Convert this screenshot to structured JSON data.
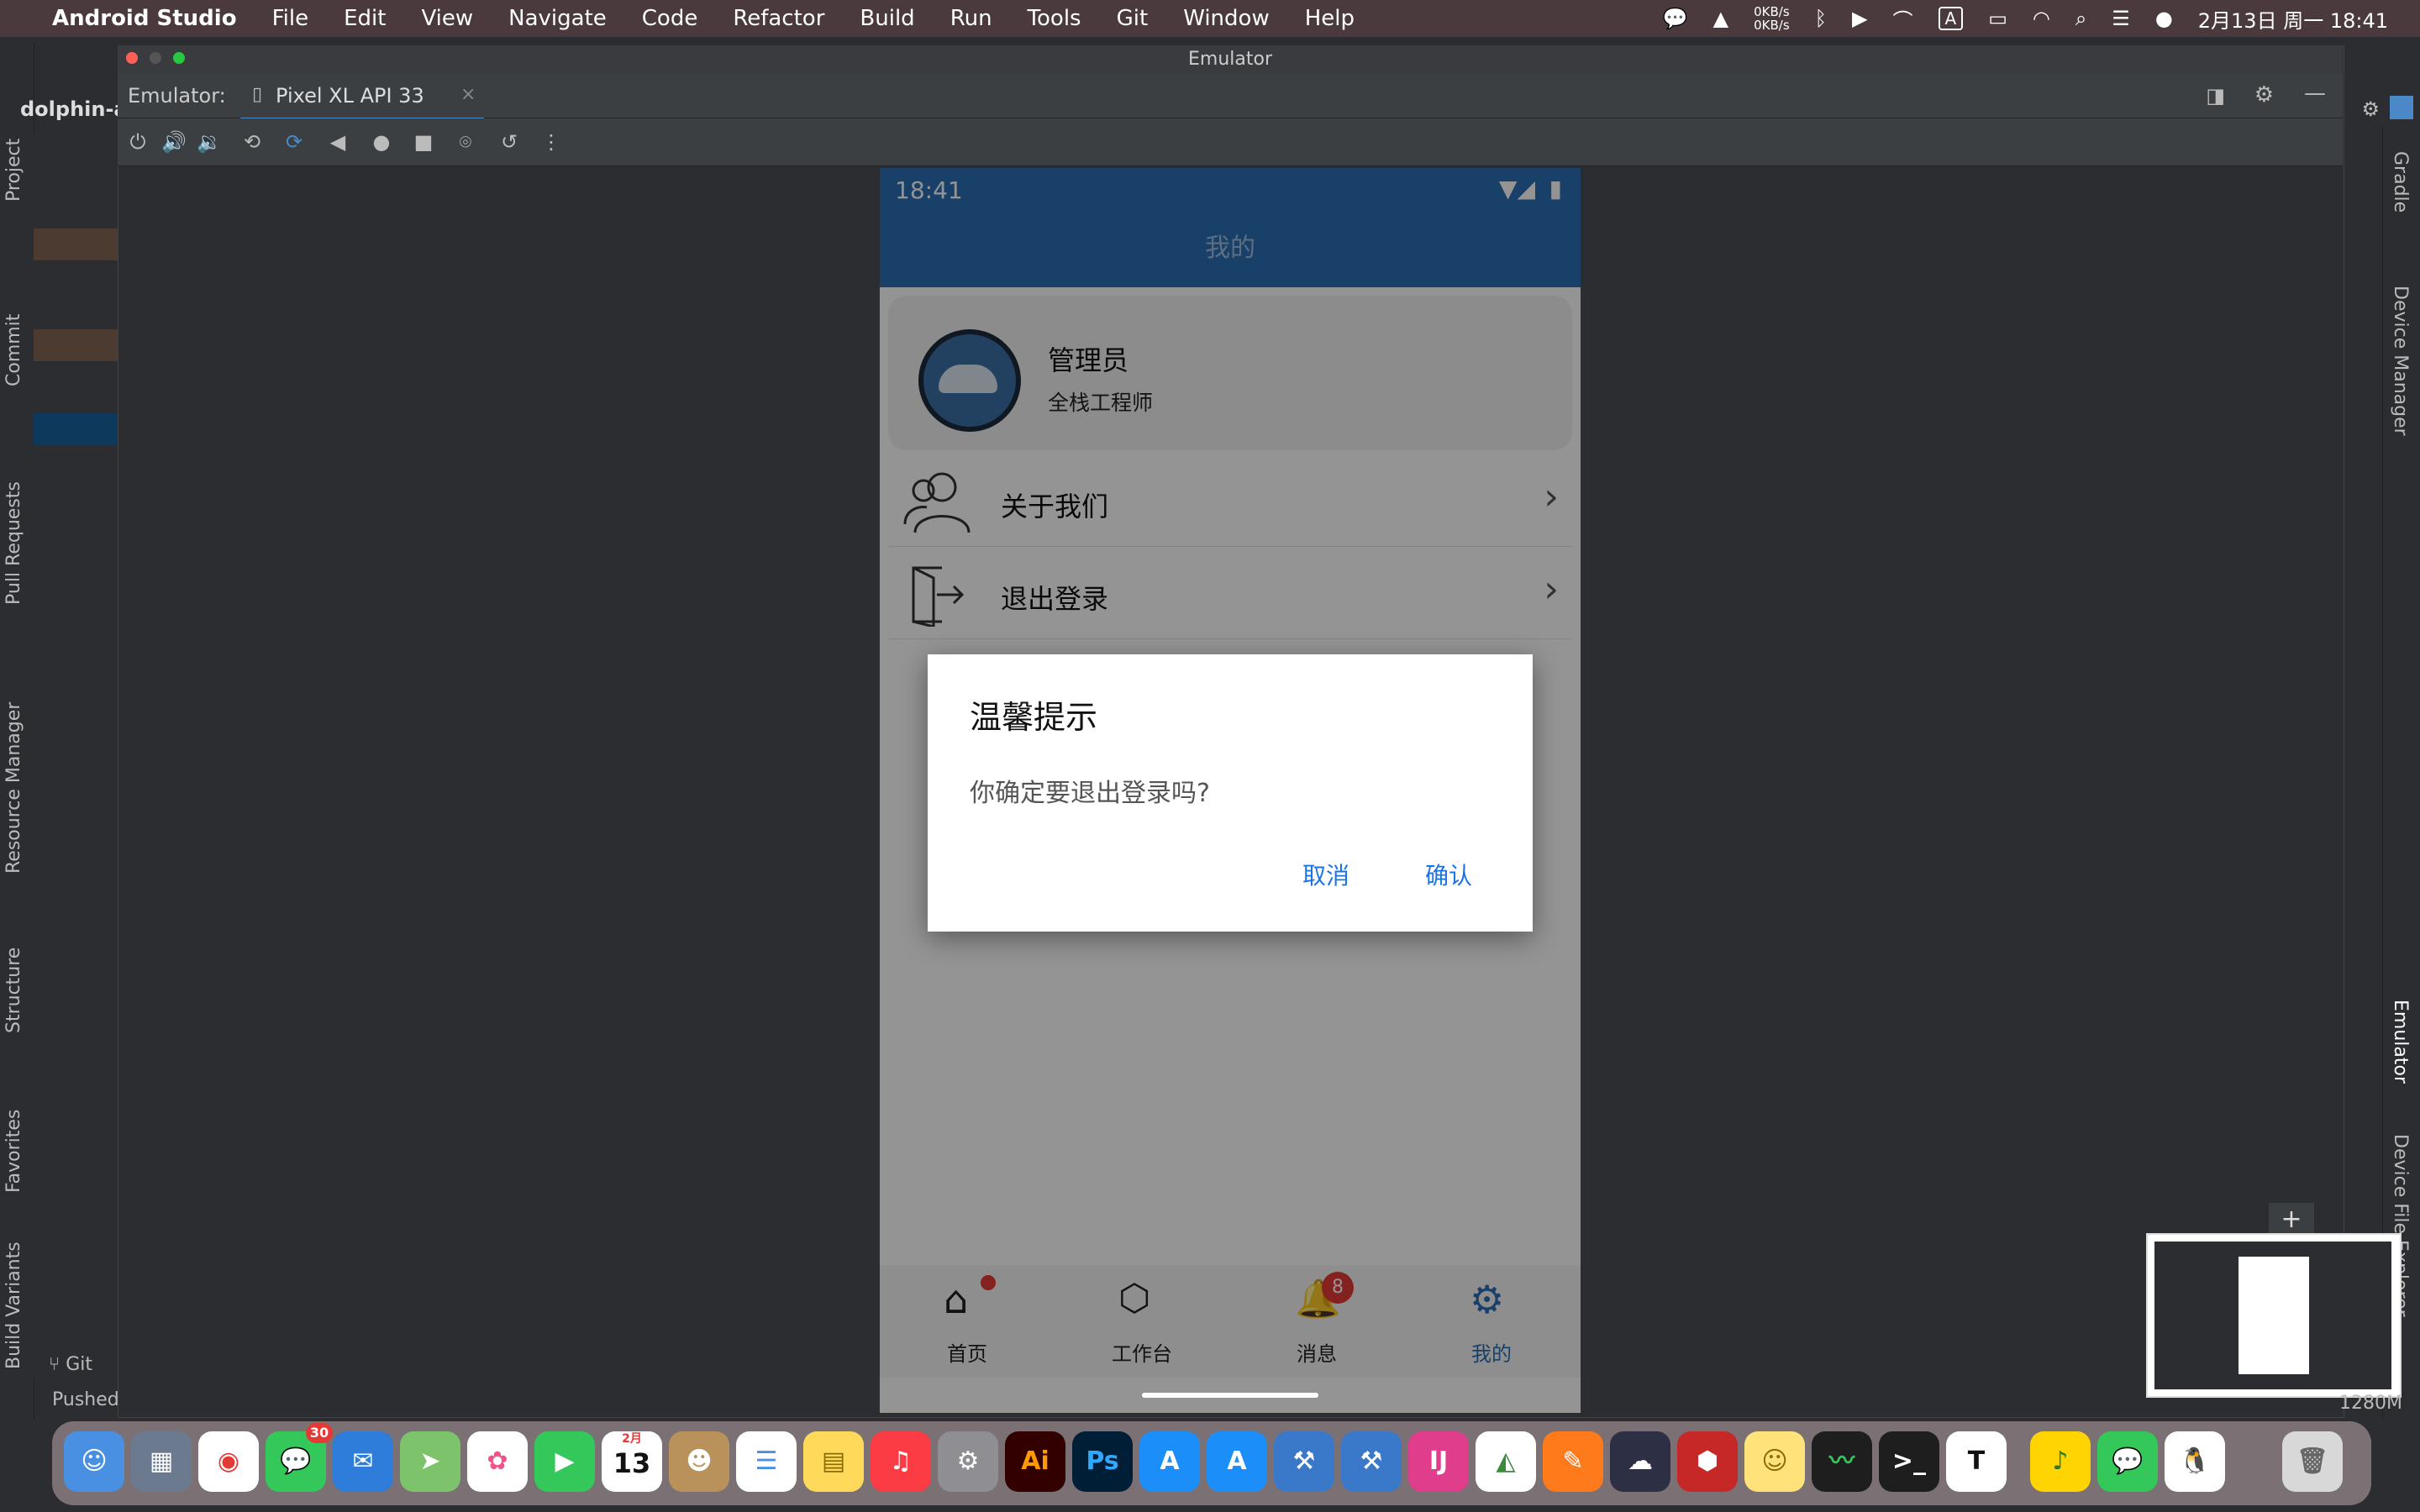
{
  "menubar": {
    "app_name": "Android Studio",
    "items": [
      "File",
      "Edit",
      "View",
      "Navigate",
      "Code",
      "Refactor",
      "Build",
      "Run",
      "Tools",
      "Git",
      "Window",
      "Help"
    ],
    "net_speed_up": "0KB/s",
    "net_speed_down": "0KB/s",
    "input_method": "A",
    "datetime": "2月13日 周一  18:41"
  },
  "ide": {
    "project_name": "dolphin-a",
    "left_tabs": [
      "Project",
      "Commit",
      "Pull Requests",
      "Resource Manager",
      "Structure",
      "Favorites",
      "Build Variants"
    ],
    "right_tabs": [
      "Gradle",
      "Device Manager",
      "Emulator",
      "Device File Explorer"
    ],
    "git_label": "Git",
    "status_text": "Pushed",
    "memory": "1280M"
  },
  "emulator": {
    "window_title": "Emulator",
    "label": "Emulator:",
    "device_tab": "Pixel XL API 33"
  },
  "phone": {
    "time": "18:41",
    "appbar_title": "我的",
    "profile": {
      "name": "管理员",
      "role": "全栈工程师"
    },
    "menu": [
      {
        "label": "关于我们",
        "icon": "users-icon"
      },
      {
        "label": "退出登录",
        "icon": "logout-icon"
      }
    ],
    "dialog": {
      "title": "温馨提示",
      "message": "你确定要退出登录吗?",
      "cancel": "取消",
      "confirm": "确认"
    },
    "tabs": [
      {
        "label": "首页",
        "icon": "home-icon",
        "badge": ""
      },
      {
        "label": "工作台",
        "icon": "cube-icon",
        "badge": ""
      },
      {
        "label": "消息",
        "icon": "bell-icon",
        "badge": "8"
      },
      {
        "label": "我的",
        "icon": "gear-icon",
        "badge": ""
      }
    ],
    "colors": {
      "primary": "#2c6fb3",
      "accent": "#1a73e8",
      "badge": "#e53935"
    }
  },
  "dock": {
    "calendar_month": "2月",
    "calendar_day": "13",
    "messages_badge": "30"
  }
}
